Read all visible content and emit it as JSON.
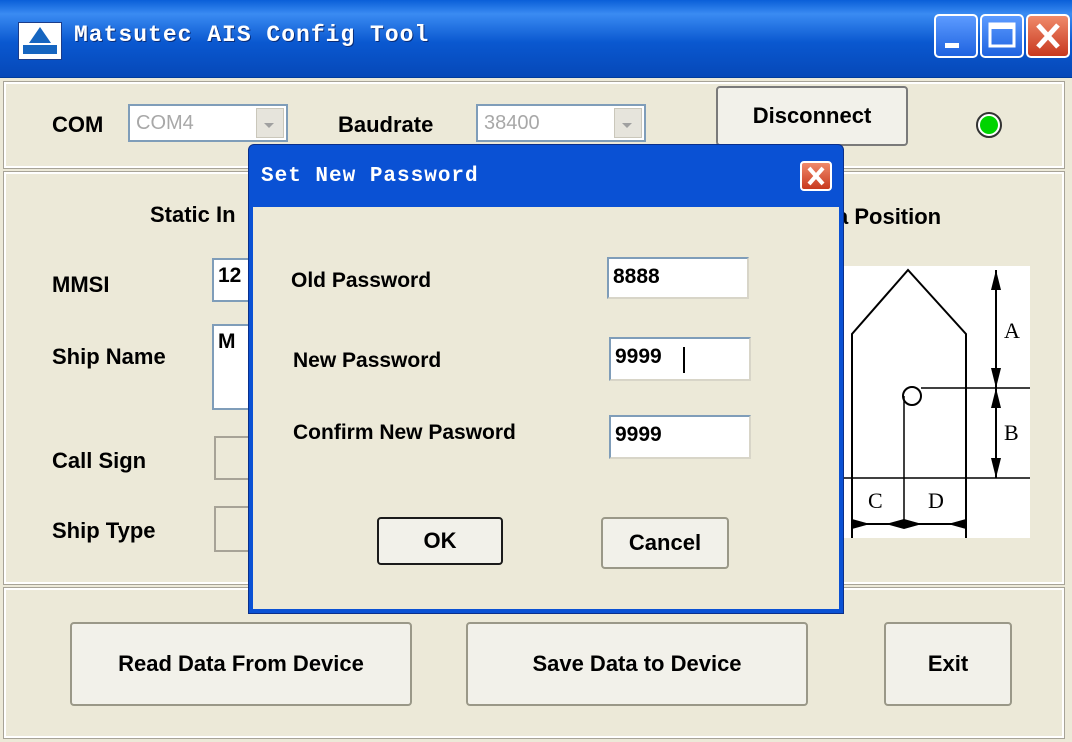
{
  "window": {
    "title": "Matsutec AIS Config Tool",
    "minimize_icon": "minimize-icon",
    "maximize_icon": "maximize-icon",
    "close_icon": "close-icon"
  },
  "connection": {
    "com_label": "COM",
    "com_value": "COM4",
    "baud_label": "Baudrate",
    "baud_value": "38400",
    "disconnect_label": "Disconnect",
    "status_color": "#00d400"
  },
  "static_info": {
    "heading": "Static In",
    "mmsi_label": "MMSI",
    "mmsi_value": "12",
    "ship_name_label": "Ship Name",
    "ship_name_value": "M",
    "call_sign_label": "Call Sign",
    "ship_type_label": "Ship Type"
  },
  "antenna": {
    "heading": "a Position",
    "labels": [
      "A",
      "B",
      "C",
      "D"
    ]
  },
  "bottom_buttons": {
    "read": "Read Data From Device",
    "save": "Save Data to Device",
    "exit": "Exit"
  },
  "dialog": {
    "title": "Set New Password",
    "old_label": "Old Password",
    "old_value": "8888",
    "new_label": "New Password",
    "new_value": "9999",
    "confirm_label": "Confirm New Pasword",
    "confirm_value": "9999",
    "ok_label": "OK",
    "cancel_label": "Cancel"
  }
}
